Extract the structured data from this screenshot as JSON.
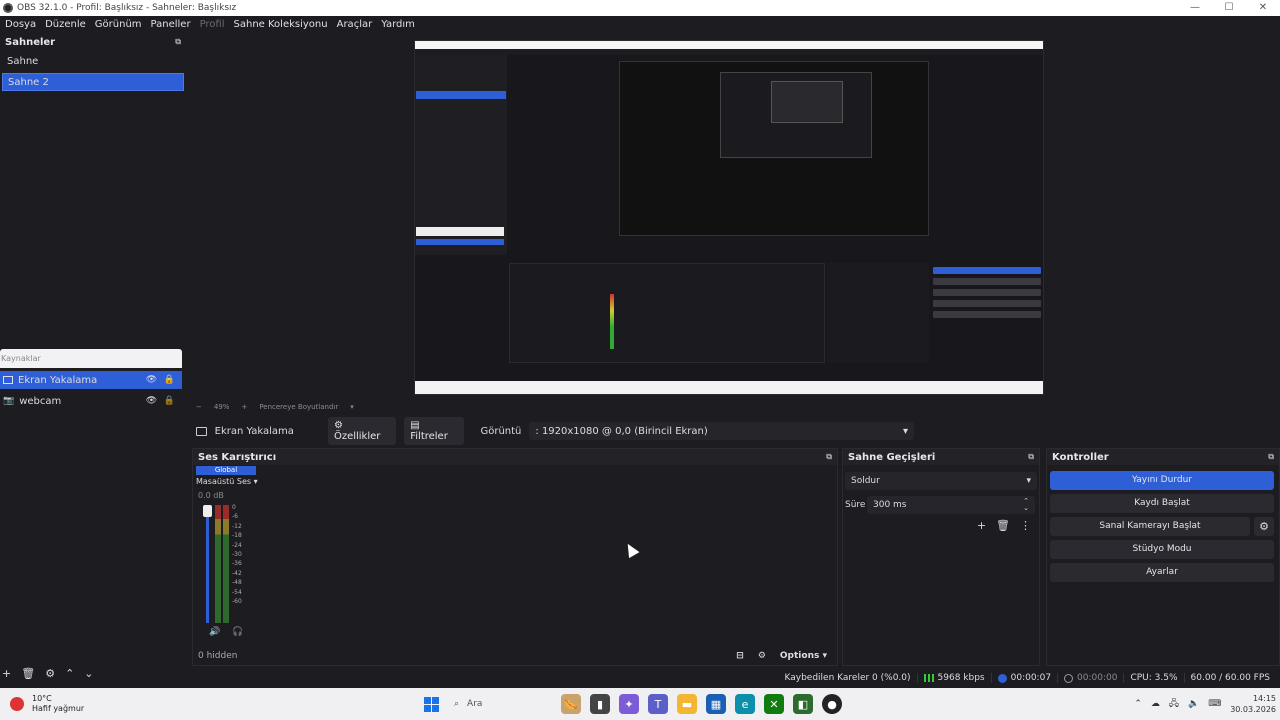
{
  "window": {
    "title": "OBS 32.1.0 - Profil: Başlıksız - Sahneler: Başlıksız"
  },
  "menu": [
    {
      "label": "Dosya",
      "disabled": false
    },
    {
      "label": "Düzenle",
      "disabled": false
    },
    {
      "label": "Görünüm",
      "disabled": false
    },
    {
      "label": "Paneller",
      "disabled": false
    },
    {
      "label": "Profil",
      "disabled": true
    },
    {
      "label": "Sahne Koleksiyonu",
      "disabled": false
    },
    {
      "label": "Araçlar",
      "disabled": false
    },
    {
      "label": "Yardım",
      "disabled": false
    }
  ],
  "scenes": {
    "title": "Sahneler",
    "items": [
      {
        "label": "Sahne",
        "selected": false
      },
      {
        "label": "Sahne 2",
        "selected": true
      }
    ]
  },
  "sources": {
    "title": "Kaynaklar",
    "items": [
      {
        "label": "Ekran Yakalama",
        "icon": "monitor-icon",
        "selected": true
      },
      {
        "label": "webcam",
        "icon": "camera-icon",
        "selected": false
      }
    ]
  },
  "preview_toolbar": {
    "zoom": "49%",
    "fit_label": "Pencereye Boyutlandır"
  },
  "context_bar": {
    "source_name": "Ekran Yakalama",
    "properties_label": "Özellikler",
    "filters_label": "Filtreler",
    "display_label": "Görüntü",
    "display_value": ": 1920x1080 @ 0,0 (Birincil Ekran)"
  },
  "mixer": {
    "title": "Ses Karıştırıcı",
    "tab": "Global",
    "track_name": "Masaüstü Ses",
    "db_value": "0.0 dB",
    "ticks": [
      "0",
      "-6",
      "-12",
      "-18",
      "-24",
      "-30",
      "-36",
      "-42",
      "-48",
      "-54",
      "-60"
    ],
    "hidden_count": "0 hidden",
    "options_label": "Options"
  },
  "transitions": {
    "title": "Sahne Geçişleri",
    "selected": "Soldur",
    "duration_label": "Süre",
    "duration_value": "300 ms"
  },
  "controls": {
    "title": "Kontroller",
    "stop_stream": "Yayını Durdur",
    "start_record": "Kaydı Başlat",
    "start_virtualcam": "Sanal Kamerayı Başlat",
    "studio_mode": "Stüdyo Modu",
    "settings": "Ayarlar"
  },
  "status": {
    "dropped_frames": "Kaybedilen Kareler 0 (%0.0)",
    "bitrate": "5968 kbps",
    "stream_time": "00:00:07",
    "record_time": "00:00:00",
    "cpu": "CPU: 3.5%",
    "fps": "60.00 / 60.00 FPS"
  },
  "taskbar": {
    "weather_temp": "10°C",
    "weather_desc": "Hafif yağmur",
    "search_placeholder": "Ara",
    "time": "14:15",
    "date": "30.03.2026"
  },
  "colors": {
    "accent": "#2f5fd6",
    "background": "#1d1d21"
  }
}
